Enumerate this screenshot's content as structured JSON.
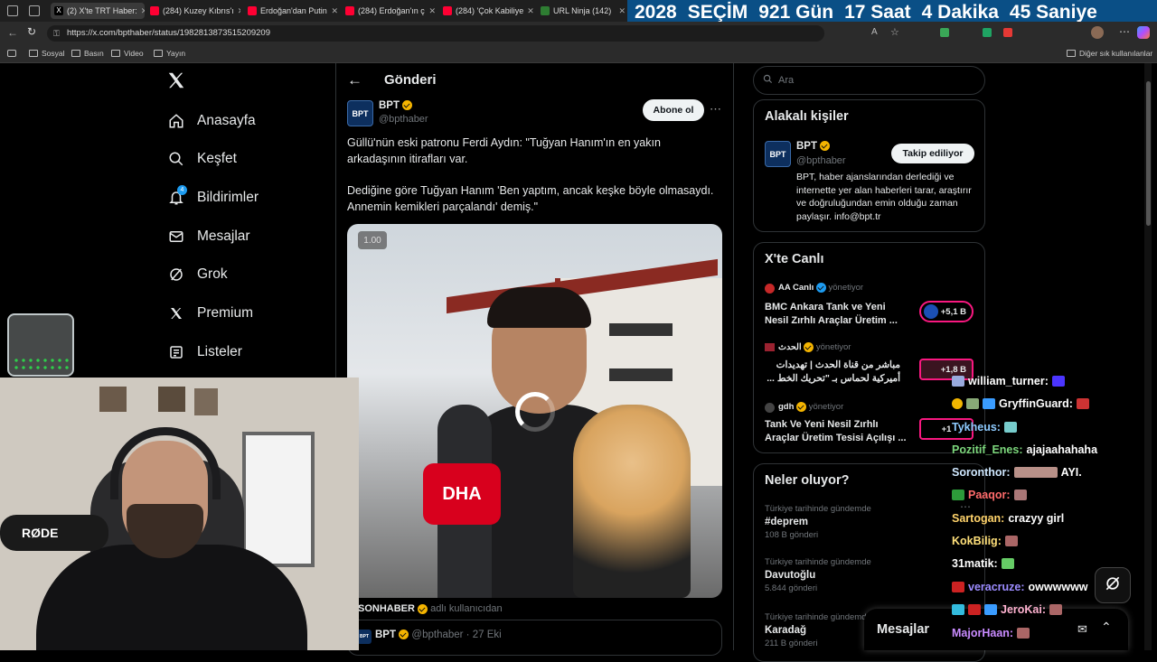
{
  "browser": {
    "tabs": [
      {
        "label": "(2) X'te TRT Haber:",
        "color": "#ffffff"
      },
      {
        "label": "(284) Kuzey Kıbrıs'ı",
        "color": "#ff0033"
      },
      {
        "label": "Erdoğan'dan Putin",
        "color": "#ff0033"
      },
      {
        "label": "(284) Erdoğan'ın ç",
        "color": "#ff0033"
      },
      {
        "label": "(284) 'Çok Kabiliye",
        "color": "#ff0033"
      },
      {
        "label": "URL Ninja (142)",
        "color": "#2e7d32"
      }
    ],
    "url": "https://x.com/bpthaber/status/1982813873515209209",
    "bookmarks": [
      "Sosyal",
      "Basın",
      "Video",
      "Yayın"
    ],
    "other_bookmarks": "Diğer sık kullanılanlar"
  },
  "countdown": {
    "year": "2028",
    "label": "SEÇİM",
    "days": "921 Gün",
    "hours": "17 Saat",
    "minutes": "4 Dakika",
    "seconds": "45 Saniye"
  },
  "nav": {
    "items": [
      {
        "label": "Anasayfa",
        "icon": "home-icon"
      },
      {
        "label": "Keşfet",
        "icon": "search-icon"
      },
      {
        "label": "Bildirimler",
        "icon": "bell-icon",
        "badge": "4"
      },
      {
        "label": "Mesajlar",
        "icon": "mail-icon"
      },
      {
        "label": "Grok",
        "icon": "grok-icon"
      },
      {
        "label": "Premium",
        "icon": "x-logo-icon"
      },
      {
        "label": "Listeler",
        "icon": "list-icon"
      }
    ]
  },
  "post": {
    "header": "Gönderi",
    "author_name": "BPT",
    "author_handle": "@bpthaber",
    "avatar_text": "BPT",
    "subscribe": "Abone ol",
    "text_p1": "Güllü'nün eski patronu Ferdi Aydın: \"Tuğyan Hanım'ın en yakın arkadaşının itirafları var.",
    "text_p2": "Dediğine göre Tuğyan Hanım 'Ben yaptım, ancak keşke böyle olmasaydı. Annemin kemikleri parçalandı' demiş.\"",
    "video_speed": "1.00",
    "mic_brand": "DHA",
    "attribution_user": "SONHABER",
    "attribution_suffix": "adlı kullanıcıdan",
    "quoted_name": "BPT",
    "quoted_handle": "@bpthaber",
    "quoted_date": "27 Eki"
  },
  "right": {
    "search_placeholder": "Ara",
    "related_title": "Alakalı kişiler",
    "related": {
      "name": "BPT",
      "handle": "@bpthaber",
      "follow": "Takip ediliyor",
      "bio": "BPT, haber ajanslarından derlediği ve internette yer alan haberleri tarar, araştırır ve doğruluğundan emin olduğu zaman paylaşır. info@bpt.tr"
    },
    "live_title": "X'te Canlı",
    "live": [
      {
        "host": "AA Canlı",
        "status": "yönetiyor",
        "title": "BMC Ankara Tank ve Yeni Nesil Zırhlı Araçlar Üretim ...",
        "count": "+5,1 B"
      },
      {
        "host": "الحدث",
        "status": "yönetiyor",
        "title": "مباشر من قناة الحدث | تهديدات أميركية لحماس بـ \"تحريك الخط ...",
        "count": "+1,8 B"
      },
      {
        "host": "gdh",
        "status": "yönetiyor",
        "title": "Tank Ve Yeni Nesil Zırhlı Araçlar Üretim Tesisi Açılışı ...",
        "count": "+1"
      }
    ],
    "trends_title": "Neler oluyor?",
    "trends": [
      {
        "context": "Türkiye tarihinde gündemde",
        "name": "#deprem",
        "count": "108 B gönderi"
      },
      {
        "context": "Türkiye tarihinde gündemde",
        "name": "Davutoğlu",
        "count": "5.844 gönderi"
      },
      {
        "context": "Türkiye tarihinde gündemde",
        "name": "Karadağ",
        "count": "211 B gönderi"
      }
    ],
    "messages_label": "Mesajlar"
  },
  "webcam": {
    "mic_brand": "RØDE"
  },
  "chat": [
    {
      "user": "william_turner:",
      "msg": "",
      "color": "#ffffff"
    },
    {
      "user": "GryffinGuard:",
      "msg": "",
      "color": "#ffffff"
    },
    {
      "user": "Tykheus:",
      "msg": "",
      "color": "#8ecbff"
    },
    {
      "user": "Pozitif_Enes:",
      "msg": "ajajaahahaha",
      "color": "#7cd67c"
    },
    {
      "user": "Soronthor:",
      "msg": "AYI.",
      "color": "#cfe8ff"
    },
    {
      "user": "Paaqor:",
      "msg": "",
      "color": "#ff6b6b"
    },
    {
      "user": "Sartogan:",
      "msg": "crazyy girl",
      "color": "#ffd36b"
    },
    {
      "user": "KokBilig:",
      "msg": "",
      "color": "#ffe07a"
    },
    {
      "user": "31matik:",
      "msg": "",
      "color": "#ffffff"
    },
    {
      "user": "veracruze:",
      "msg": "owwwwww",
      "color": "#9c8cff"
    },
    {
      "user": "JeroKai:",
      "msg": "",
      "color": "#ffb3d1"
    },
    {
      "user": "MajorHaan:",
      "msg": "",
      "color": "#c98bff"
    }
  ]
}
